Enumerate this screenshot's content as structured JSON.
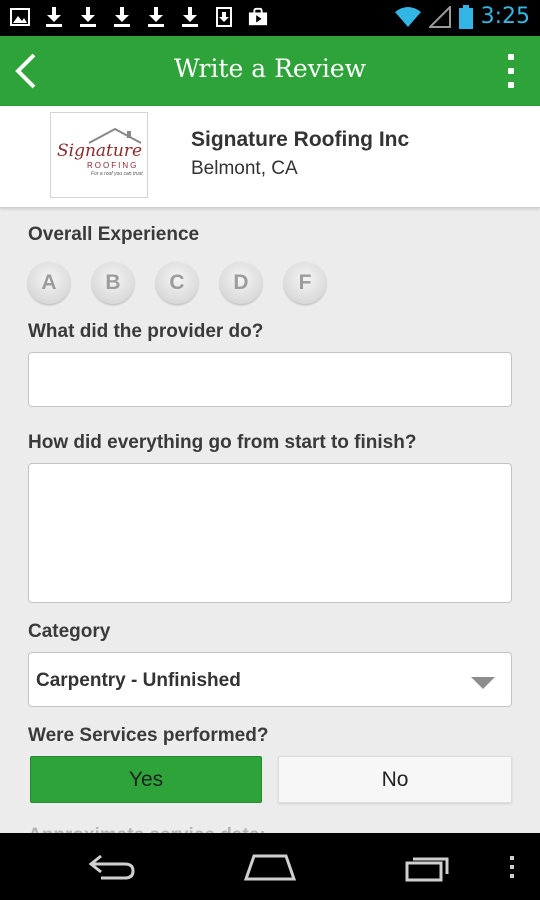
{
  "status_bar": {
    "time": "3:25",
    "left_icons": [
      "image-icon",
      "download-icon",
      "download-icon",
      "download-icon",
      "download-icon",
      "download-icon",
      "sd-card-icon",
      "shopping-bag-icon"
    ],
    "right_icons": [
      "wifi-icon",
      "signal-icon",
      "battery-icon"
    ]
  },
  "action_bar": {
    "title": "Write a Review",
    "color": "#2ea33a"
  },
  "provider": {
    "name": "Signature Roofing Inc",
    "location": "Belmont, CA",
    "logo": {
      "script": "Signature",
      "sub": "ROOFING",
      "tagline": "For a roof you can trust"
    }
  },
  "form": {
    "overall_label": "Overall Experience",
    "grades": [
      "A",
      "B",
      "C",
      "D",
      "F"
    ],
    "q1_label": "What did the provider do?",
    "q1_value": "",
    "q2_label": "How did everything go from start to finish?",
    "q2_value": "",
    "category_label": "Category",
    "category_value": "Carpentry - Unfinished",
    "services_label": "Were Services performed?",
    "yes_label": "Yes",
    "no_label": "No",
    "selected": "Yes",
    "next_label": "Approximate service date:"
  },
  "nav_bar": {
    "icons": [
      "back-nav-icon",
      "home-nav-icon",
      "recent-apps-icon",
      "menu-icon"
    ]
  }
}
